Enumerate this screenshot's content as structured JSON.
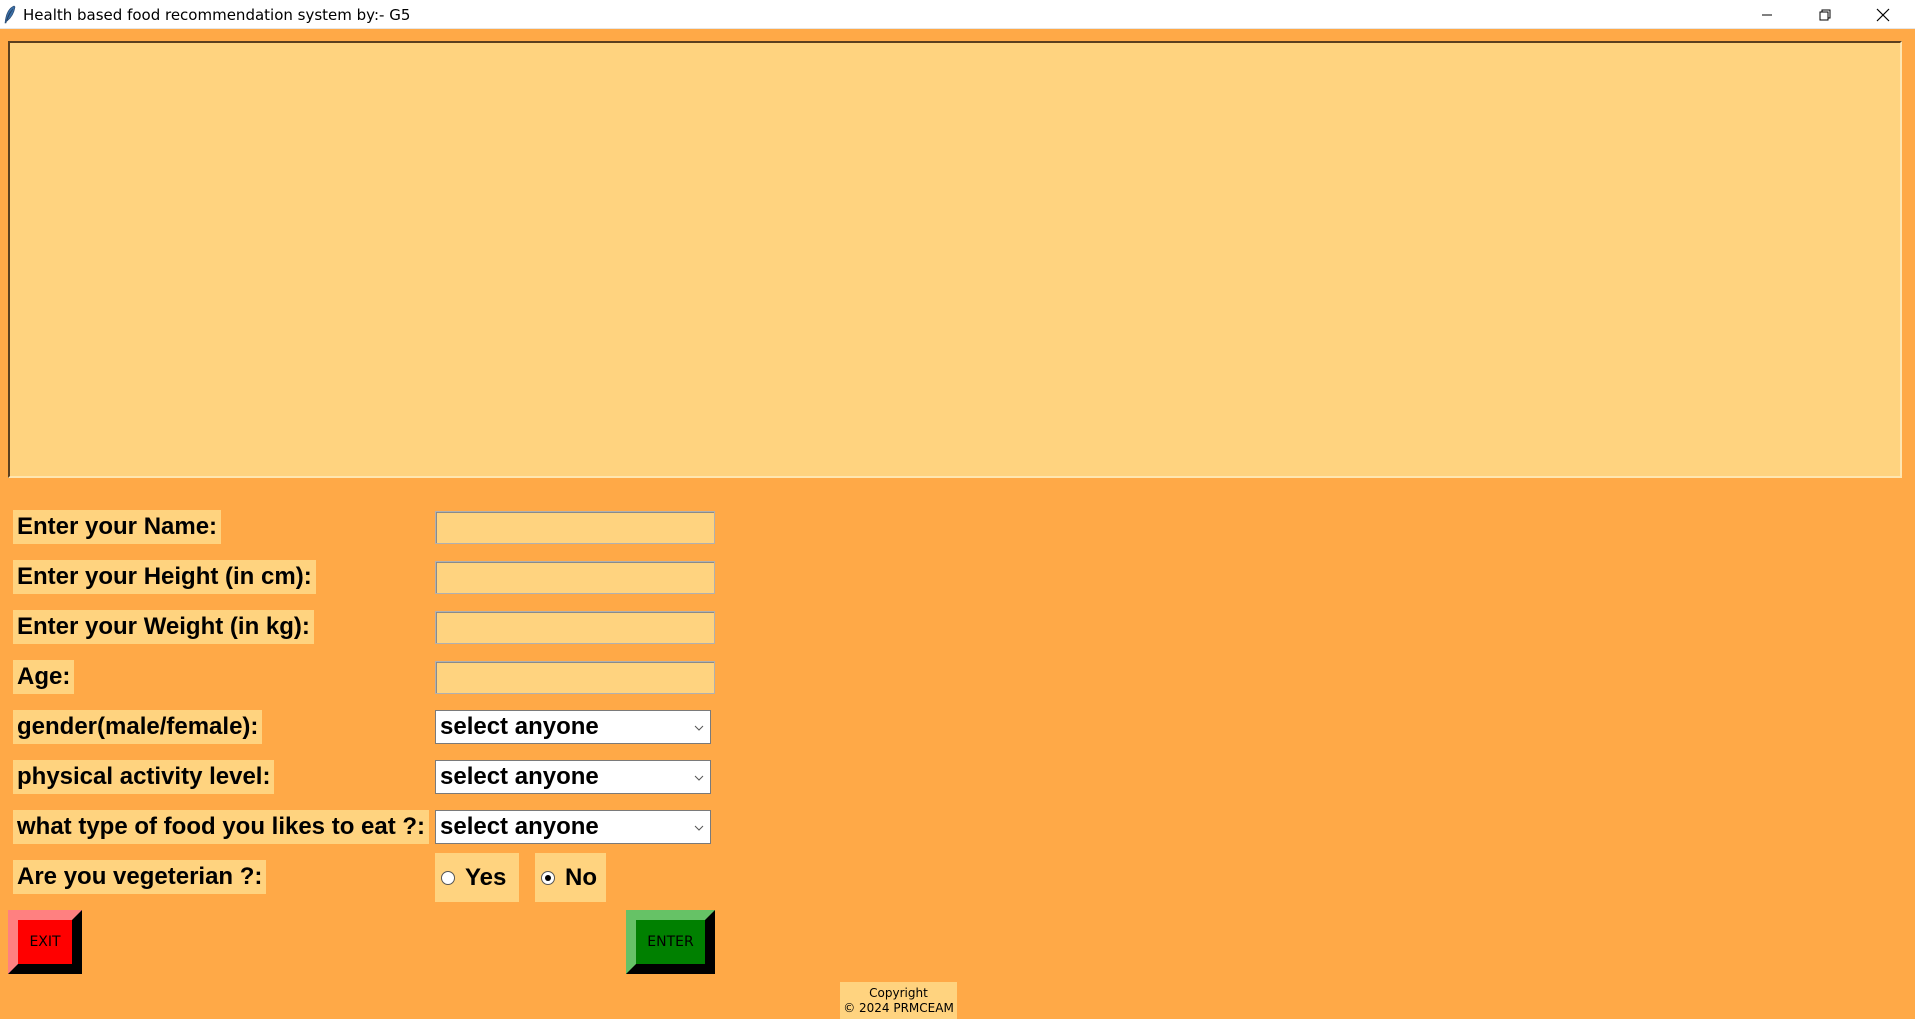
{
  "window": {
    "title": "Health based food recommendation system by:- G5"
  },
  "form": {
    "name_label": "Enter your Name:",
    "height_label": "Enter your Height (in cm):",
    "weight_label": "Enter your Weight (in kg):",
    "age_label": "Age:",
    "gender_label": "gender(male/female):",
    "activity_label": "physical activity level:",
    "food_type_label": "what type of food you likes to eat ?:",
    "veg_label": "Are you vegeterian ?:",
    "name_value": "",
    "height_value": "",
    "weight_value": "",
    "age_value": "",
    "gender_selected": "select anyone",
    "activity_selected": "select anyone",
    "food_type_selected": "select anyone",
    "veg_options": [
      "Yes",
      "No"
    ],
    "veg_selected": "No"
  },
  "buttons": {
    "exit_label": "EXIT",
    "enter_label": "ENTER"
  },
  "footer": {
    "copyright_line1": "Copyright",
    "copyright_line2": "© 2024 PRMCEAM"
  },
  "colors": {
    "background": "#ffa947",
    "panel": "#ffd37f",
    "exit_button": "#ff0000",
    "enter_button": "#008000"
  }
}
